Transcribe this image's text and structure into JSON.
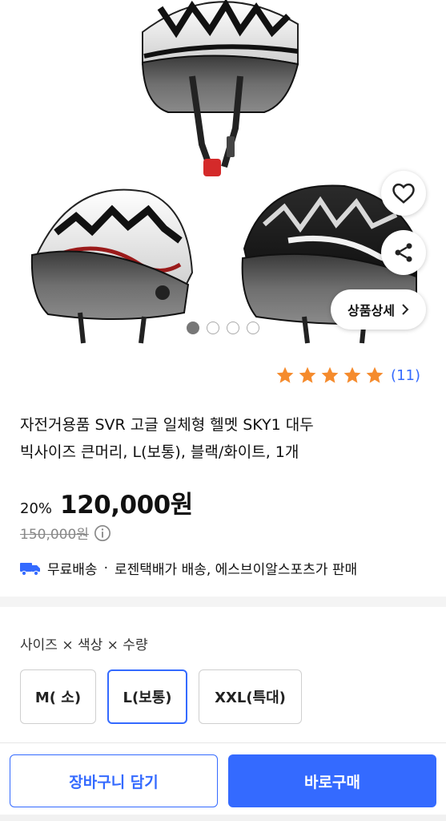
{
  "gallery": {
    "detail_button_label": "상품상세",
    "image_count": 4,
    "active_index": 0,
    "icons": [
      "heart-icon",
      "share-icon",
      "chevron-right-icon"
    ]
  },
  "rating": {
    "stars": 5,
    "max_stars": 5,
    "review_count": "(11)",
    "star_color": "#f58b2d"
  },
  "product": {
    "title_line1": "자전거용품 SVR 고글 일체형 헬멧 SKY1 대두",
    "title_line2": "빅사이즈 큰머리, L(보통), 블랙/화이트, 1개",
    "discount": "20%",
    "price": "120,000원",
    "original_price": "150,000원"
  },
  "shipping": {
    "free": "무료배송",
    "separator": "·",
    "detail": "로젠택배가 배송, 에스브이알스포츠가 판매"
  },
  "options": {
    "label": "사이즈 × 색상 × 수량",
    "items": [
      {
        "label": "M( 소)",
        "selected": false
      },
      {
        "label": "L(보통)",
        "selected": true
      },
      {
        "label": "XXL(특대)",
        "selected": false
      }
    ]
  },
  "actions": {
    "cart": "장바구니 담기",
    "buy": "바로구매"
  },
  "colors": {
    "accent": "#346aff",
    "text": "#111111"
  }
}
